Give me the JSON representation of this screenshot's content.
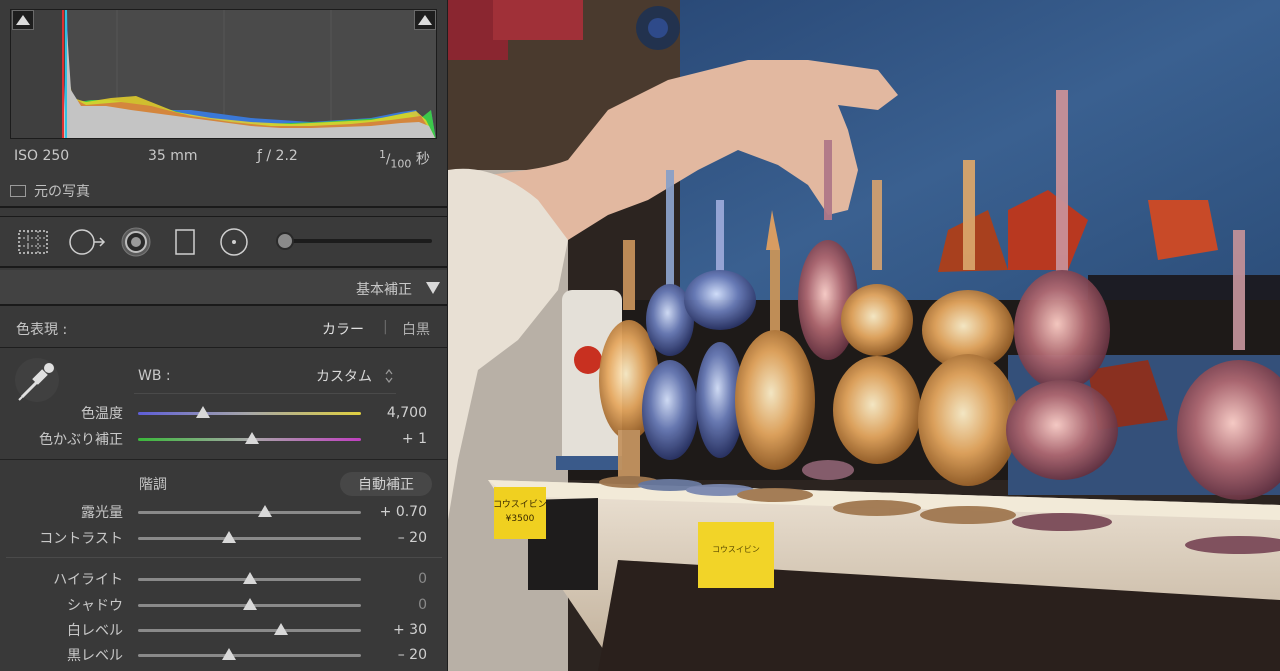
{
  "histogram": {
    "iso": "ISO 250",
    "focal": "35 mm",
    "aperture": "ƒ / 2.2",
    "shutter_num": "1",
    "shutter_den": "100",
    "shutter_unit": "秒",
    "original_photo_label": "元の写真"
  },
  "tools": {
    "icons": [
      "crop-overlay-icon",
      "spot-removal-icon",
      "red-eye-icon",
      "graduated-filter-icon",
      "radial-filter-icon",
      "adjustment-brush-icon"
    ]
  },
  "basic": {
    "title": "基本補正",
    "treatment_label": "色表現 :",
    "treatment_color": "カラー",
    "treatment_divider": "|",
    "treatment_bw": "白黒",
    "wb_label": "WB :",
    "wb_value": "カスタム",
    "tone_label": "階調",
    "auto_label": "自動補正",
    "sliders": {
      "temp": {
        "label": "色温度",
        "value": "4,700",
        "pos": 0.29
      },
      "tint": {
        "label": "色かぶり補正",
        "value": "+ 1",
        "pos": 0.51
      },
      "exposure": {
        "label": "露光量",
        "value": "+ 0.70",
        "pos": 0.57
      },
      "contrast": {
        "label": "コントラスト",
        "value": "– 20",
        "pos": 0.41
      },
      "highlights": {
        "label": "ハイライト",
        "value": "0",
        "pos": 0.5
      },
      "shadows": {
        "label": "シャドウ",
        "value": "0",
        "pos": 0.5
      },
      "whites": {
        "label": "白レベル",
        "value": "+ 30",
        "pos": 0.64
      },
      "blacks": {
        "label": "黒レベル",
        "value": "– 20",
        "pos": 0.41
      }
    }
  },
  "photo": {
    "tag1_line1": "コウスイビン",
    "tag1_line2": "¥3500",
    "tag2_text": "コウスイビン"
  },
  "colors": {
    "panel_bg": "#393939",
    "accent": "#d8d8d8",
    "price_tag": "#f0d020"
  }
}
